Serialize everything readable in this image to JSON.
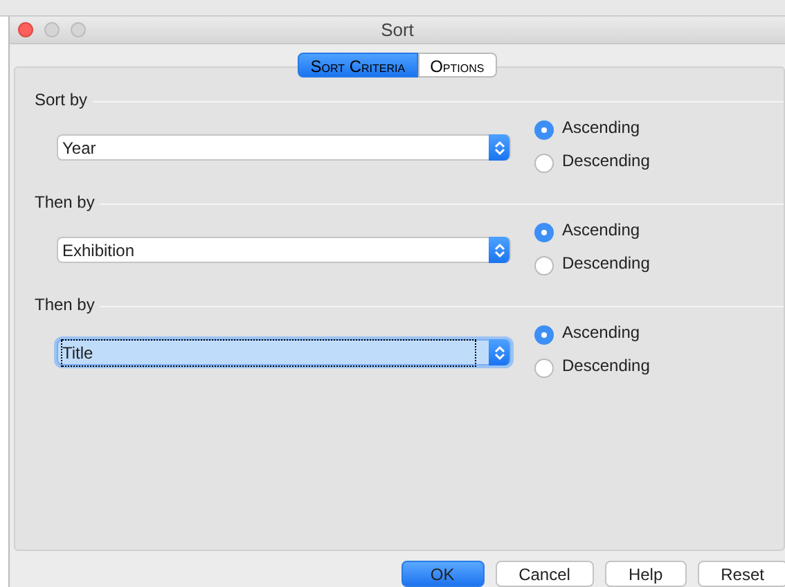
{
  "window": {
    "title": "Sort"
  },
  "tabs": [
    {
      "label": "Sort Criteria",
      "selected": true
    },
    {
      "label": "Options",
      "selected": false
    }
  ],
  "groups": [
    {
      "label": "Sort by",
      "value": "Year",
      "focused": false,
      "options": [
        {
          "label": "Ascending",
          "selected": true
        },
        {
          "label": "Descending",
          "selected": false
        }
      ]
    },
    {
      "label": "Then by",
      "value": "Exhibition",
      "focused": false,
      "options": [
        {
          "label": "Ascending",
          "selected": true
        },
        {
          "label": "Descending",
          "selected": false
        }
      ]
    },
    {
      "label": "Then by",
      "value": "Title",
      "focused": true,
      "options": [
        {
          "label": "Ascending",
          "selected": true
        },
        {
          "label": "Descending",
          "selected": false
        }
      ]
    }
  ],
  "buttons": [
    {
      "label": "OK",
      "default": true
    },
    {
      "label": "Cancel",
      "default": false
    },
    {
      "label": "Help",
      "default": false
    },
    {
      "label": "Reset",
      "default": false
    }
  ]
}
